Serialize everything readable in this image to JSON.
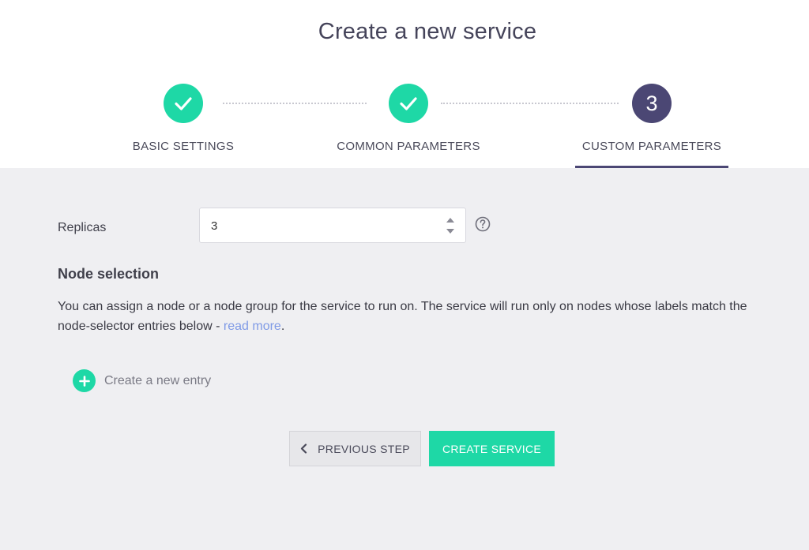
{
  "page": {
    "title": "Create a new service"
  },
  "wizard": {
    "steps": [
      {
        "label": "BASIC SETTINGS",
        "state": "done",
        "icon": "check-icon"
      },
      {
        "label": "COMMON PARAMETERS",
        "state": "done",
        "icon": "check-icon"
      },
      {
        "label": "CUSTOM PARAMETERS",
        "state": "current",
        "number": "3"
      }
    ]
  },
  "form": {
    "replicas_label": "Replicas",
    "replicas_value": "3",
    "help_icon": "question-circle-icon"
  },
  "node_selection": {
    "title": "Node selection",
    "description": "You can assign a node or a node group for the service to run on. The service will run only on nodes whose labels match the node-selector entries below - ",
    "link_text": "read more",
    "after_link": ".",
    "new_entry_label": "Create a new entry"
  },
  "actions": {
    "previous_label": "PREVIOUS STEP",
    "create_label": "CREATE SERVICE"
  },
  "colors": {
    "accent": "#1ed8a6",
    "current_step": "#4b4774",
    "link": "#7f9ae6",
    "content_bg": "#efeff2"
  }
}
